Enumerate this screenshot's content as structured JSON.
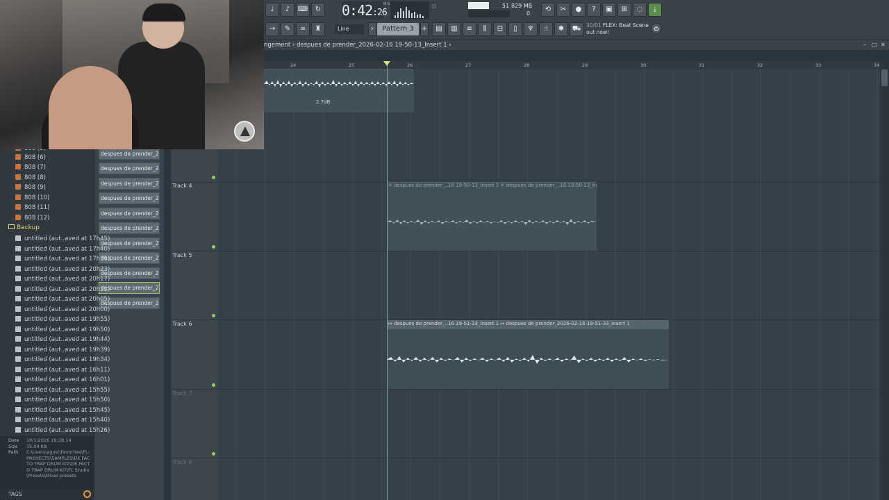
{
  "toolbar": {
    "time": "0:42",
    "time_frac": ":26",
    "time_unit": "M:S:CS",
    "cpu_value": "51",
    "ram_value": "829 MB",
    "voices": "0",
    "snap_mode": "Line",
    "pattern": "Pattern 3",
    "news_count": "30/01",
    "news_text": "FLEX: Beat Scene out now!"
  },
  "playlist": {
    "breadcrumb_prefix": "ngement",
    "breadcrumb": "despues de prender_2026-02-16 19-50-13_Insert 1",
    "ruler": [
      "24",
      "25",
      "26",
      "27",
      "28",
      "29",
      "30",
      "31",
      "32",
      "33",
      "34"
    ],
    "tracks": [
      {
        "label": "Track 4",
        "active": true
      },
      {
        "label": "Track 5",
        "active": true
      },
      {
        "label": "Track 6",
        "active": true
      },
      {
        "label": "Track 7",
        "active": false
      },
      {
        "label": "Track 8",
        "active": false
      }
    ],
    "clips": {
      "top_gain": "2.7dB",
      "track4_a": "despues de prender_..16 19-50-13_Insert 1",
      "track4_b": "despues de prender_..16 19-50-13_Insert 1",
      "track6_a": "despues de prender_..16 19-51-33_Insert 1",
      "track6_b": "despues de prender_2026-02-16 19-51-33_Insert 1"
    }
  },
  "picker": {
    "items": [
      "despues de prender_202...",
      "despues de prender_202...",
      "despues de prender_202...",
      "despues de prender_202...",
      "despues de prender_202...",
      "despues de prender_202...",
      "despues de prender_202...",
      "despues de prender_202...",
      "despues de prender_202...",
      "despues de prender_202...",
      "despues de prender_202..."
    ]
  },
  "browser": {
    "drum_items": [
      "808 (5)",
      "808 (6)",
      "808 (7)",
      "808 (8)",
      "808 (9)",
      "808 (10)",
      "808 (11)",
      "808 (12)"
    ],
    "folder": "Backup",
    "files": [
      "untitled (aut..aved at 17h45)",
      "untitled (aut..aved at 17h40)",
      "untitled (aut..aved at 17h35)",
      "untitled (aut..aved at 20h23)",
      "untitled (aut..aved at 20h17)",
      "untitled (aut..aved at 20h12)",
      "untitled (aut..aved at 20h05)",
      "untitled (aut..aved at 20h00)",
      "untitled (aut..aved at 19h55)",
      "untitled (aut..aved at 19h50)",
      "untitled (aut..aved at 19h44)",
      "untitled (aut..aved at 19h39)",
      "untitled (aut..aved at 19h34)",
      "untitled (aut..aved at 16h11)",
      "untitled (aut..aved at 16h01)",
      "untitled (aut..aved at 15h55)",
      "untitled (aut..aved at 15h50)",
      "untitled (aut..aved at 15h45)",
      "untitled (aut..aved at 15h40)",
      "untitled (aut..aved at 15h26)"
    ],
    "info": {
      "date_label": "Date",
      "date": "10/1/2026 19:28:14",
      "size_label": "Size",
      "size": "35.04 KB",
      "path_label": "Path",
      "path": "C:\\Users\\agust\\Favorites\\FL-PROYECTS\\SAMPLES\\DE FACTO TRAP DRUM KIT\\DE FACTO TRAP DRUM KIT\\FL Studio\\Presets\\Mixer presets"
    },
    "tags_label": "TAGS"
  },
  "icons": [
    "metronome-icon",
    "step-icon",
    "typing-keyboard-icon",
    "wait-icon",
    "play-icon",
    "draw-icon",
    "paint-icon",
    "link-icon",
    "stamp-icon",
    "playlist-icon",
    "piano-roll-icon",
    "channel-rack-icon",
    "mixer-icon",
    "browser-icon",
    "plugin-icon",
    "touch-icon",
    "undo-icon",
    "record-icon",
    "help-icon",
    "save-icon",
    "midi-icon",
    "chat-icon",
    "download-icon",
    "search-icon"
  ]
}
